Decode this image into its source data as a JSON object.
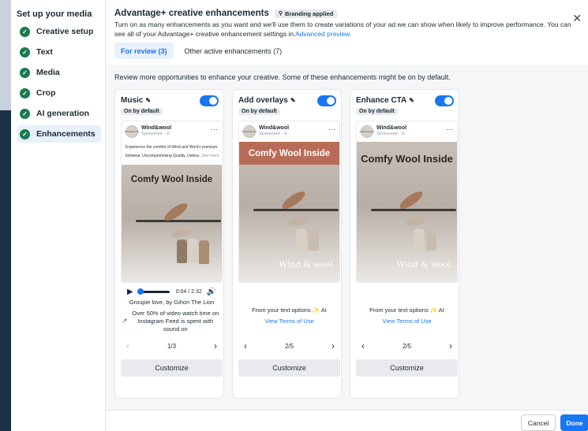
{
  "sidebar": {
    "title": "Set up your media",
    "items": [
      {
        "label": "Creative setup",
        "icon": "check-circle-icon"
      },
      {
        "label": "Text",
        "icon": "check-circle-icon"
      },
      {
        "label": "Media",
        "icon": "check-circle-icon"
      },
      {
        "label": "Crop",
        "icon": "check-circle-icon"
      },
      {
        "label": "AI generation",
        "icon": "check-circle-icon"
      },
      {
        "label": "Enhancements",
        "icon": "check-circle-icon",
        "active": true
      }
    ]
  },
  "header": {
    "title": "Advantage+ creative enhancements",
    "badge": "Branding applied",
    "description": "Turn on as many enhancements as you want and we'll use them to create variations of your ad we can show when likely to improve performance. You can see all of your Advantage+ creative enhancement settings in",
    "link": "Advanced preview.",
    "tabs": [
      "For review (3)",
      "Other active enhancements (7)"
    ]
  },
  "intro": "Review more opportunities to enhance your creative. Some of these enhancements might be on by default.",
  "colors": {
    "accent": "#1877f2",
    "success": "#1c7a4f",
    "overlay_band": "#b86b57"
  },
  "cards": [
    {
      "title": "Music",
      "toggle_on": true,
      "chip": "On by default",
      "preview": {
        "brand": "Wind&wool",
        "sponsored": "Sponsored · ⊘",
        "avatar_text": "WIND&WOOL",
        "text": "Experience the comfort of Wind and Wool's premium knitwear. Uncompromising Quality. Unbea",
        "see_more": "...See more",
        "headline": "Comfy Wool Inside"
      },
      "audio": {
        "time": "0:04 / 2:32",
        "progress": 0.03
      },
      "song": "Groupie love, by Gihon The Lion",
      "stat": "Over 50% of video watch time on Instagram Feed is spent with sound on",
      "page": "1/3",
      "button": "Customize"
    },
    {
      "title": "Add overlays",
      "toggle_on": true,
      "chip": "On by default",
      "preview": {
        "brand": "Wind&wool",
        "sponsored": "Sponsored · ⊘",
        "avatar_text": "WIND&WOOL",
        "headline": "Comfy Wool Inside",
        "signature": "Wind & wool"
      },
      "ai_line": "From your text options ✨ AI",
      "terms": "View Terms of Use",
      "page": "2/5",
      "button": "Customize"
    },
    {
      "title": "Enhance CTA",
      "toggle_on": true,
      "chip": "On by default",
      "preview": {
        "brand": "Wind&wool",
        "sponsored": "Sponsored · ⊘",
        "avatar_text": "WIND&WOOL",
        "headline": "Comfy Wool Inside",
        "signature": "Wind & wool"
      },
      "ai_line": "From your text options ✨ AI",
      "terms": "View Terms of Use",
      "page": "2/5",
      "button": "Customize"
    }
  ],
  "footer": {
    "cancel": "Cancel",
    "done": "Done"
  }
}
